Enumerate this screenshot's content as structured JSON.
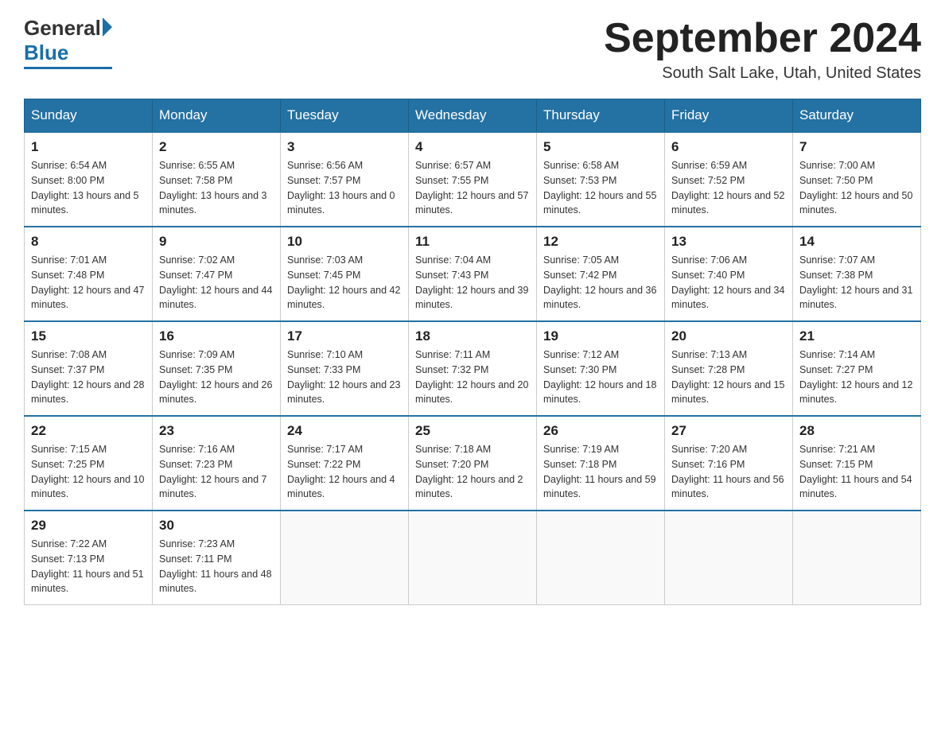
{
  "header": {
    "logo_general": "General",
    "logo_blue": "Blue",
    "month_title": "September 2024",
    "location": "South Salt Lake, Utah, United States"
  },
  "weekdays": [
    "Sunday",
    "Monday",
    "Tuesday",
    "Wednesday",
    "Thursday",
    "Friday",
    "Saturday"
  ],
  "weeks": [
    [
      {
        "day": "1",
        "sunrise": "6:54 AM",
        "sunset": "8:00 PM",
        "daylight": "13 hours and 5 minutes."
      },
      {
        "day": "2",
        "sunrise": "6:55 AM",
        "sunset": "7:58 PM",
        "daylight": "13 hours and 3 minutes."
      },
      {
        "day": "3",
        "sunrise": "6:56 AM",
        "sunset": "7:57 PM",
        "daylight": "13 hours and 0 minutes."
      },
      {
        "day": "4",
        "sunrise": "6:57 AM",
        "sunset": "7:55 PM",
        "daylight": "12 hours and 57 minutes."
      },
      {
        "day": "5",
        "sunrise": "6:58 AM",
        "sunset": "7:53 PM",
        "daylight": "12 hours and 55 minutes."
      },
      {
        "day": "6",
        "sunrise": "6:59 AM",
        "sunset": "7:52 PM",
        "daylight": "12 hours and 52 minutes."
      },
      {
        "day": "7",
        "sunrise": "7:00 AM",
        "sunset": "7:50 PM",
        "daylight": "12 hours and 50 minutes."
      }
    ],
    [
      {
        "day": "8",
        "sunrise": "7:01 AM",
        "sunset": "7:48 PM",
        "daylight": "12 hours and 47 minutes."
      },
      {
        "day": "9",
        "sunrise": "7:02 AM",
        "sunset": "7:47 PM",
        "daylight": "12 hours and 44 minutes."
      },
      {
        "day": "10",
        "sunrise": "7:03 AM",
        "sunset": "7:45 PM",
        "daylight": "12 hours and 42 minutes."
      },
      {
        "day": "11",
        "sunrise": "7:04 AM",
        "sunset": "7:43 PM",
        "daylight": "12 hours and 39 minutes."
      },
      {
        "day": "12",
        "sunrise": "7:05 AM",
        "sunset": "7:42 PM",
        "daylight": "12 hours and 36 minutes."
      },
      {
        "day": "13",
        "sunrise": "7:06 AM",
        "sunset": "7:40 PM",
        "daylight": "12 hours and 34 minutes."
      },
      {
        "day": "14",
        "sunrise": "7:07 AM",
        "sunset": "7:38 PM",
        "daylight": "12 hours and 31 minutes."
      }
    ],
    [
      {
        "day": "15",
        "sunrise": "7:08 AM",
        "sunset": "7:37 PM",
        "daylight": "12 hours and 28 minutes."
      },
      {
        "day": "16",
        "sunrise": "7:09 AM",
        "sunset": "7:35 PM",
        "daylight": "12 hours and 26 minutes."
      },
      {
        "day": "17",
        "sunrise": "7:10 AM",
        "sunset": "7:33 PM",
        "daylight": "12 hours and 23 minutes."
      },
      {
        "day": "18",
        "sunrise": "7:11 AM",
        "sunset": "7:32 PM",
        "daylight": "12 hours and 20 minutes."
      },
      {
        "day": "19",
        "sunrise": "7:12 AM",
        "sunset": "7:30 PM",
        "daylight": "12 hours and 18 minutes."
      },
      {
        "day": "20",
        "sunrise": "7:13 AM",
        "sunset": "7:28 PM",
        "daylight": "12 hours and 15 minutes."
      },
      {
        "day": "21",
        "sunrise": "7:14 AM",
        "sunset": "7:27 PM",
        "daylight": "12 hours and 12 minutes."
      }
    ],
    [
      {
        "day": "22",
        "sunrise": "7:15 AM",
        "sunset": "7:25 PM",
        "daylight": "12 hours and 10 minutes."
      },
      {
        "day": "23",
        "sunrise": "7:16 AM",
        "sunset": "7:23 PM",
        "daylight": "12 hours and 7 minutes."
      },
      {
        "day": "24",
        "sunrise": "7:17 AM",
        "sunset": "7:22 PM",
        "daylight": "12 hours and 4 minutes."
      },
      {
        "day": "25",
        "sunrise": "7:18 AM",
        "sunset": "7:20 PM",
        "daylight": "12 hours and 2 minutes."
      },
      {
        "day": "26",
        "sunrise": "7:19 AM",
        "sunset": "7:18 PM",
        "daylight": "11 hours and 59 minutes."
      },
      {
        "day": "27",
        "sunrise": "7:20 AM",
        "sunset": "7:16 PM",
        "daylight": "11 hours and 56 minutes."
      },
      {
        "day": "28",
        "sunrise": "7:21 AM",
        "sunset": "7:15 PM",
        "daylight": "11 hours and 54 minutes."
      }
    ],
    [
      {
        "day": "29",
        "sunrise": "7:22 AM",
        "sunset": "7:13 PM",
        "daylight": "11 hours and 51 minutes."
      },
      {
        "day": "30",
        "sunrise": "7:23 AM",
        "sunset": "7:11 PM",
        "daylight": "11 hours and 48 minutes."
      },
      null,
      null,
      null,
      null,
      null
    ]
  ]
}
